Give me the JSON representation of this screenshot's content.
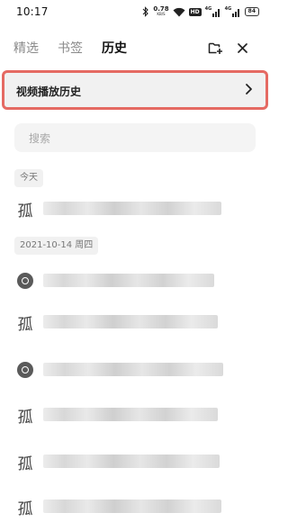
{
  "status_bar": {
    "time": "10:17",
    "net_speed": "0.78",
    "net_unit": "KB/S",
    "hd_label": "HD",
    "signal_1": "4G",
    "signal_2": "4G",
    "battery": "84"
  },
  "tabs": [
    {
      "label": "精选",
      "active": false
    },
    {
      "label": "书签",
      "active": false
    },
    {
      "label": "历史",
      "active": true
    }
  ],
  "toolbar": {
    "add_icon": "add-folder-icon",
    "close_icon": "close-icon"
  },
  "video_history": {
    "label": "视频播放历史",
    "chevron_icon": "chevron-right-icon",
    "highlight_color": "#e56a63"
  },
  "search": {
    "placeholder": "搜索"
  },
  "groups": [
    {
      "date": "今天"
    },
    {
      "date": "2021-10-14 周四"
    }
  ],
  "history_rows": [
    {
      "icon": "gu",
      "glyph": "孤"
    },
    {
      "icon": "site-globe-icon"
    },
    {
      "icon": "gu",
      "glyph": "孤"
    },
    {
      "icon": "site-globe-icon"
    },
    {
      "icon": "gu",
      "glyph": "孤"
    },
    {
      "icon": "gu",
      "glyph": "孤"
    },
    {
      "icon": "gu",
      "glyph": "孤"
    }
  ]
}
